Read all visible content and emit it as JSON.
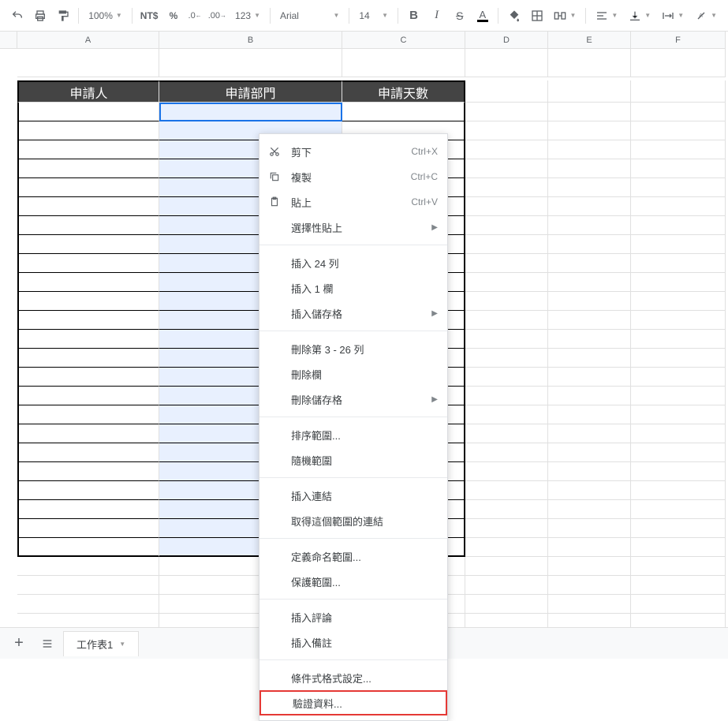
{
  "toolbar": {
    "zoom": "100%",
    "currency": "NT$",
    "percent": "%",
    "dec_minus": ".0",
    "dec_plus": ".00",
    "more_fmt": "123",
    "font": "Arial",
    "font_size": "14"
  },
  "columns": [
    "A",
    "B",
    "C",
    "D",
    "E",
    "F"
  ],
  "table": {
    "headers": [
      "申請人",
      "申請部門",
      "申請天數"
    ]
  },
  "context_menu": {
    "cut": {
      "label": "剪下",
      "shortcut": "Ctrl+X"
    },
    "copy": {
      "label": "複製",
      "shortcut": "Ctrl+C"
    },
    "paste": {
      "label": "貼上",
      "shortcut": "Ctrl+V"
    },
    "paste_special": "選擇性貼上",
    "insert_rows": "插入 24 列",
    "insert_col": "插入 1 欄",
    "insert_cells": "插入儲存格",
    "delete_rows": "刪除第 3 - 26 列",
    "delete_col": "刪除欄",
    "delete_cells": "刪除儲存格",
    "sort_range": "排序範圍...",
    "random_range": "隨機範圍",
    "insert_link": "插入連結",
    "get_link": "取得這個範圍的連結",
    "define_name": "定義命名範圍...",
    "protect_range": "保護範圍...",
    "insert_comment": "插入評論",
    "insert_note": "插入備註",
    "conditional_format": "條件式格式設定...",
    "data_validation": "驗證資料..."
  },
  "tabs": {
    "sheet1": "工作表1"
  }
}
